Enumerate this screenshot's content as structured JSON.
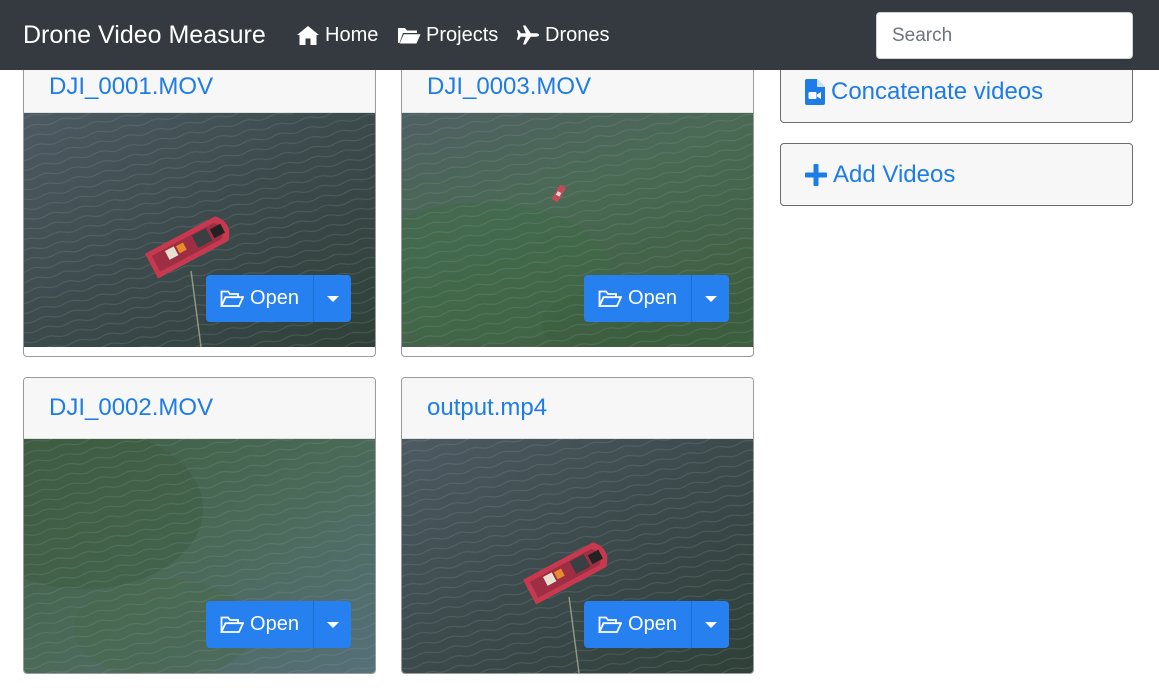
{
  "navbar": {
    "brand": "Drone Video Measure",
    "links": [
      {
        "label": "Home",
        "icon": "home-icon"
      },
      {
        "label": "Projects",
        "icon": "folder-open-icon"
      },
      {
        "label": "Drones",
        "icon": "plane-icon"
      }
    ],
    "search": {
      "placeholder": "Search",
      "value": ""
    }
  },
  "videos": [
    {
      "title": "DJI_0001.MOV",
      "scene": "boat-close",
      "open_label": "Open"
    },
    {
      "title": "DJI_0003.MOV",
      "scene": "boat-far",
      "open_label": "Open"
    },
    {
      "title": "DJI_0002.MOV",
      "scene": "water-shallow",
      "open_label": "Open"
    },
    {
      "title": "output.mp4",
      "scene": "boat-close",
      "open_label": "Open"
    }
  ],
  "actions": {
    "concatenate": {
      "label": "Concatenate videos",
      "icon": "file-video-icon"
    },
    "add_videos": {
      "label": "Add Videos",
      "icon": "plus-icon"
    }
  },
  "colors": {
    "navbar_bg": "#343a40",
    "accent": "#2680f0",
    "link": "#1e7ce6"
  }
}
